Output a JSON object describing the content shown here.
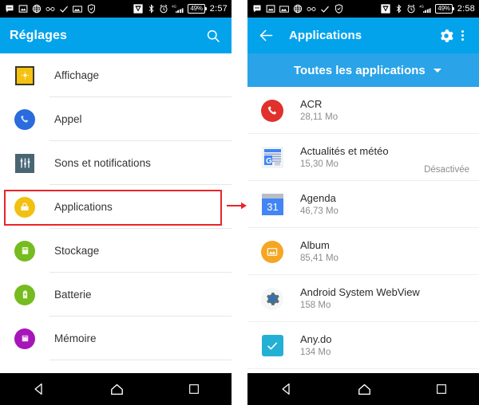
{
  "left_phone": {
    "statusbar": {
      "icons": [
        "sms-icon",
        "photo-frame-icon",
        "globe-icon",
        "glasses-icon",
        "check-icon",
        "image-icon",
        "shield-check-icon"
      ],
      "right_icons": [
        "vpn-shield-icon",
        "bluetooth-icon",
        "alarm-icon",
        "signal-4g-icon"
      ],
      "battery_text": "49",
      "battery_suffix": "%",
      "clock": "2:57"
    },
    "appbar": {
      "title": "Réglages",
      "search_icon": "search-icon"
    },
    "items": [
      {
        "label": "Affichage",
        "icon": "display-icon",
        "color": "#f5c211"
      },
      {
        "label": "Appel",
        "icon": "phone-icon",
        "color": "#2a6bdd"
      },
      {
        "label": "Sons et notifications",
        "icon": "sliders-icon",
        "color": "#4a6572"
      },
      {
        "label": "Applications",
        "icon": "apps-box-icon",
        "color": "#f2c012"
      },
      {
        "label": "Stockage",
        "icon": "storage-icon",
        "color": "#76bb1f"
      },
      {
        "label": "Batterie",
        "icon": "battery-icon",
        "color": "#76bb1f"
      },
      {
        "label": "Mémoire",
        "icon": "memory-icon",
        "color": "#a615b9"
      }
    ],
    "highlight": {
      "target_label": "Applications",
      "color": "#e8252a"
    },
    "navbar": [
      "back-icon",
      "home-icon",
      "recents-icon"
    ]
  },
  "arrow": {
    "name": "red-arrow-icon",
    "color": "#e8252a"
  },
  "right_phone": {
    "statusbar": {
      "icons": [
        "sms-icon",
        "photo-frame-icon",
        "image-icon",
        "globe-icon",
        "glasses-icon",
        "check-icon",
        "shield-check-icon"
      ],
      "right_icons": [
        "vpn-shield-icon",
        "bluetooth-icon",
        "alarm-icon",
        "signal-4g-icon"
      ],
      "battery_text": "49",
      "battery_suffix": "%",
      "clock": "2:58"
    },
    "appbar": {
      "back_icon": "back-arrow-icon",
      "title": "Applications",
      "settings_icon": "gear-icon",
      "overflow_icon": "overflow-menu-icon"
    },
    "filter": {
      "label": "Toutes les applications",
      "caret_icon": "chevron-down-icon"
    },
    "apps": [
      {
        "name": "ACR",
        "size": "28,11 Mo",
        "state": "",
        "icon": "acr-phone-icon"
      },
      {
        "name": "Actualités et météo",
        "size": "15,30 Mo",
        "state": "Désactivée",
        "icon": "google-news-icon"
      },
      {
        "name": "Agenda",
        "size": "46,73 Mo",
        "state": "",
        "icon": "calendar-31-icon"
      },
      {
        "name": "Album",
        "size": "85,41 Mo",
        "state": "",
        "icon": "album-photo-icon"
      },
      {
        "name": "Android System WebView",
        "size": "158 Mo",
        "state": "",
        "icon": "gear-blue-icon"
      },
      {
        "name": "Any.do",
        "size": "134 Mo",
        "state": "",
        "icon": "anydo-check-icon"
      }
    ],
    "navbar": [
      "back-icon",
      "home-icon",
      "recents-icon"
    ]
  }
}
